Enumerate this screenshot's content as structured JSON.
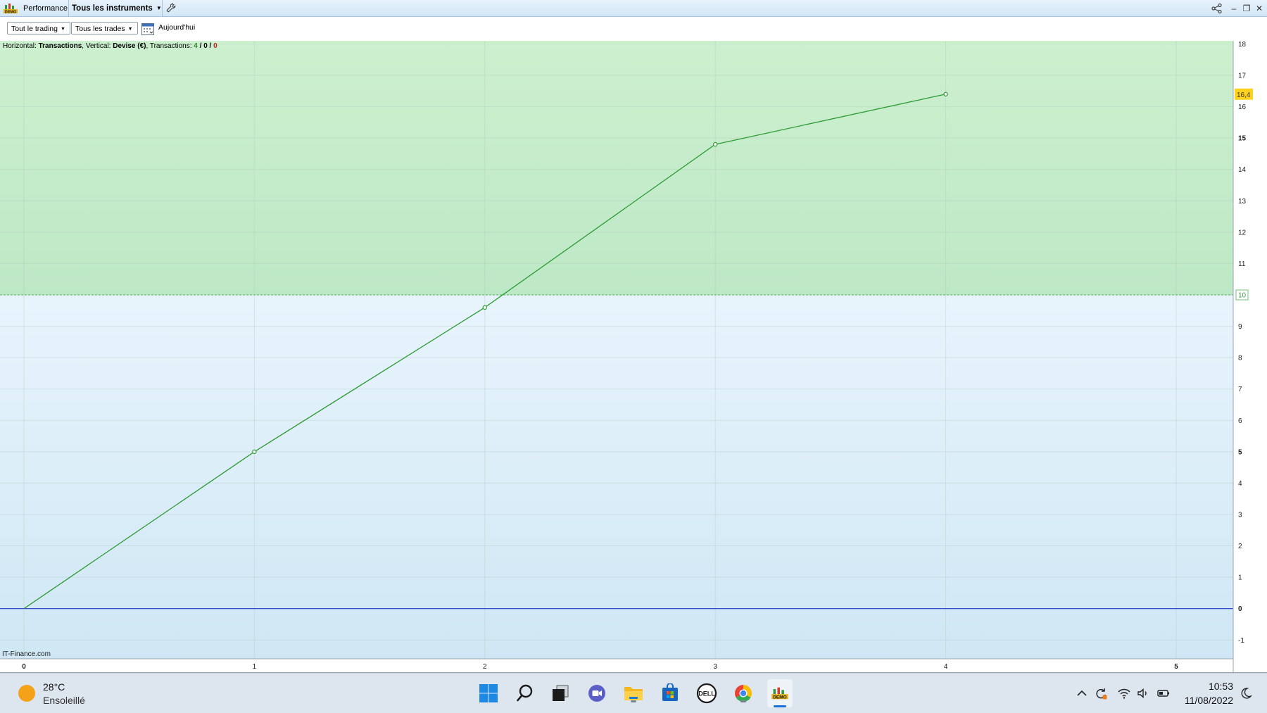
{
  "titlebar": {
    "tab_performance": "Performance",
    "tab_instruments": "Tous les instruments",
    "logo_icon": "demo-logo-icon",
    "wrench_icon": "wrench-icon"
  },
  "toolbar": {
    "trading_filter": "Tout le trading",
    "trades_filter": "Tous les trades",
    "date_label": "Aujourd'hui",
    "calendar_icon": "calendar-icon"
  },
  "chart_info": {
    "horizontal_label": "Horizontal:",
    "horizontal_value": "Transactions",
    "vertical_label": ", Vertical:",
    "vertical_value": "Devise (€)",
    "transactions_label": ", Transactions:",
    "tx_positive": "4",
    "tx_sep1": " / ",
    "tx_neutral": "0",
    "tx_sep2": " / ",
    "tx_negative": "0"
  },
  "watermark": "IT-Finance.com",
  "chart_data": {
    "type": "line",
    "x": [
      0,
      1,
      2,
      3,
      4
    ],
    "y": [
      0,
      5,
      9.6,
      14.8,
      16.4
    ],
    "xlim": [
      0,
      5.25
    ],
    "ylim": [
      -1.6,
      18.1
    ],
    "x_ticks": [
      "0",
      "1",
      "2",
      "3",
      "4",
      "5"
    ],
    "y_ticks": [
      "-1",
      "0",
      "1",
      "2",
      "3",
      "4",
      "5",
      "6",
      "7",
      "8",
      "9",
      "10",
      "11",
      "12",
      "13",
      "14",
      "15",
      "16",
      "17",
      "18"
    ],
    "reference_line": 10,
    "reference_label": "10",
    "last_value_label": "16,4",
    "zero_line": 0,
    "colors": {
      "above_zone": "#c6edcc",
      "below_zone": "#d9edf8",
      "line": "#2e9a35",
      "zero_line": "#2233cc",
      "badge": "#ffd21e"
    },
    "grid": true
  },
  "taskbar": {
    "weather_temp": "28°C",
    "weather_desc": "Ensoleillé",
    "weather_icon": "sun-icon",
    "clock_time": "10:53",
    "clock_date": "11/08/2022",
    "apps": [
      "windows-start-icon",
      "search-icon",
      "task-view-icon",
      "teams-chat-icon",
      "file-explorer-icon",
      "microsoft-store-icon",
      "dell-icon",
      "chrome-icon",
      "prorealtime-icon"
    ],
    "tray": [
      "chevron-up-icon",
      "sync-icon",
      "wifi-icon",
      "volume-icon",
      "battery-icon",
      "moon-icon"
    ]
  }
}
